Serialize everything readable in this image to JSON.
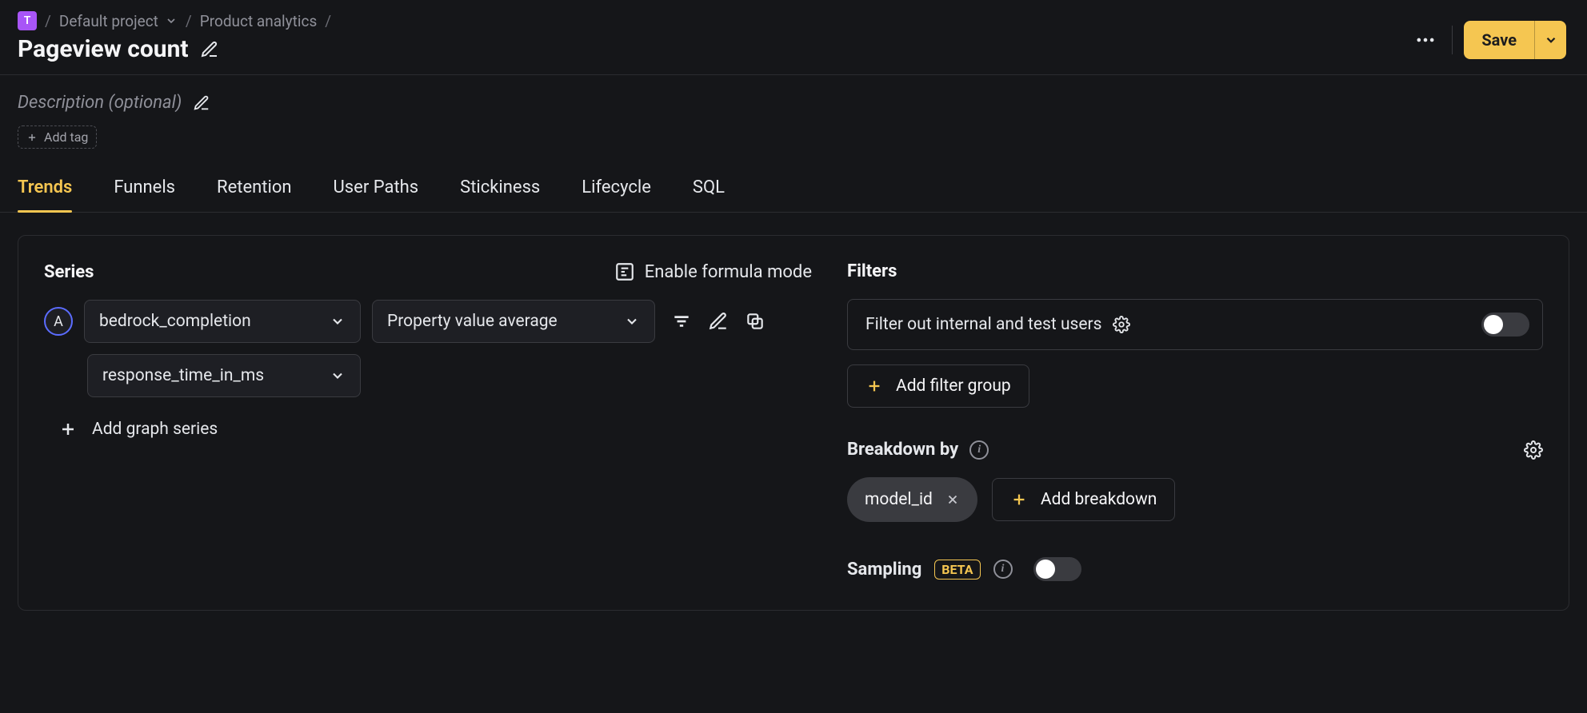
{
  "breadcrumb": {
    "project_initial": "T",
    "project_label": "Default project",
    "section_label": "Product analytics"
  },
  "page": {
    "title": "Pageview count",
    "description_placeholder": "Description (optional)",
    "add_tag_label": "Add tag"
  },
  "header": {
    "save_label": "Save"
  },
  "tabs": [
    {
      "id": "trends",
      "label": "Trends",
      "active": true
    },
    {
      "id": "funnels",
      "label": "Funnels",
      "active": false
    },
    {
      "id": "retention",
      "label": "Retention",
      "active": false
    },
    {
      "id": "user-paths",
      "label": "User Paths",
      "active": false
    },
    {
      "id": "stickiness",
      "label": "Stickiness",
      "active": false
    },
    {
      "id": "lifecycle",
      "label": "Lifecycle",
      "active": false
    },
    {
      "id": "sql",
      "label": "SQL",
      "active": false
    }
  ],
  "series": {
    "section_label": "Series",
    "formula_toggle_label": "Enable formula mode",
    "items": [
      {
        "letter": "A",
        "event": "bedrock_completion",
        "aggregation": "Property value average",
        "property": "response_time_in_ms"
      }
    ],
    "add_label": "Add graph series"
  },
  "filters": {
    "section_label": "Filters",
    "internal_filter_label": "Filter out internal and test users",
    "internal_filter_enabled": false,
    "add_group_label": "Add filter group"
  },
  "breakdown": {
    "section_label": "Breakdown by",
    "chips": [
      {
        "label": "model_id"
      }
    ],
    "add_label": "Add breakdown"
  },
  "sampling": {
    "label": "Sampling",
    "badge": "BETA",
    "enabled": false
  },
  "colors": {
    "accent": "#f5c651",
    "series_ring": "#5b6cff"
  }
}
